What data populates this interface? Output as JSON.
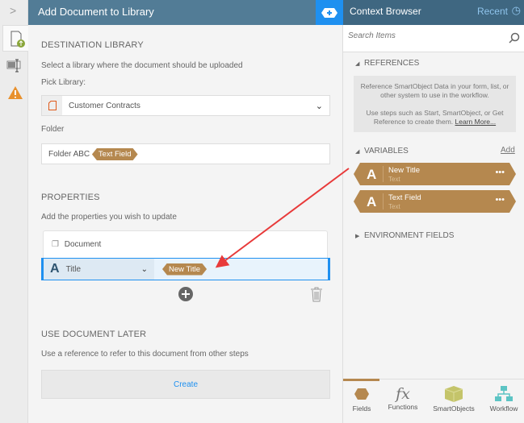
{
  "main": {
    "title": "Add Document to Library",
    "destination": {
      "heading": "DESTINATION LIBRARY",
      "description": "Select a library where the document should be uploaded",
      "pick_label": "Pick Library:",
      "library_value": "Customer Contracts",
      "folder_label": "Folder",
      "folder_value": "Folder ABC",
      "folder_tag": "Text Field"
    },
    "properties": {
      "heading": "PROPERTIES",
      "description": "Add the properties you wish to update",
      "rows": [
        {
          "label": "Document"
        },
        {
          "label": "Title",
          "value_tag": "New Title"
        }
      ]
    },
    "later": {
      "heading": "USE DOCUMENT LATER",
      "description": "Use a reference to refer to this document from other steps",
      "create_label": "Create"
    }
  },
  "context": {
    "title": "Context Browser",
    "recent_label": "Recent",
    "search_placeholder": "Search Items",
    "references": {
      "heading": "REFERENCES",
      "info1": "Reference SmartObject Data in your form, list, or other system to use in the workflow.",
      "info2": "Use steps such as Start, SmartObject, or Get Reference to create them.",
      "learn_more": "Learn More..."
    },
    "variables": {
      "heading": "VARIABLES",
      "add_label": "Add",
      "items": [
        {
          "name": "New Title",
          "type": "Text"
        },
        {
          "name": "Text Field",
          "type": "Text"
        }
      ]
    },
    "environment": {
      "heading": "ENVIRONMENT FIELDS"
    },
    "tabs": [
      {
        "label": "Fields"
      },
      {
        "label": "Functions"
      },
      {
        "label": "SmartObjects"
      },
      {
        "label": "Workflow"
      }
    ]
  },
  "colors": {
    "header": "#527c96",
    "accent": "#1e90f0",
    "tag": "#b5884f",
    "arrow": "#e83a3a"
  }
}
